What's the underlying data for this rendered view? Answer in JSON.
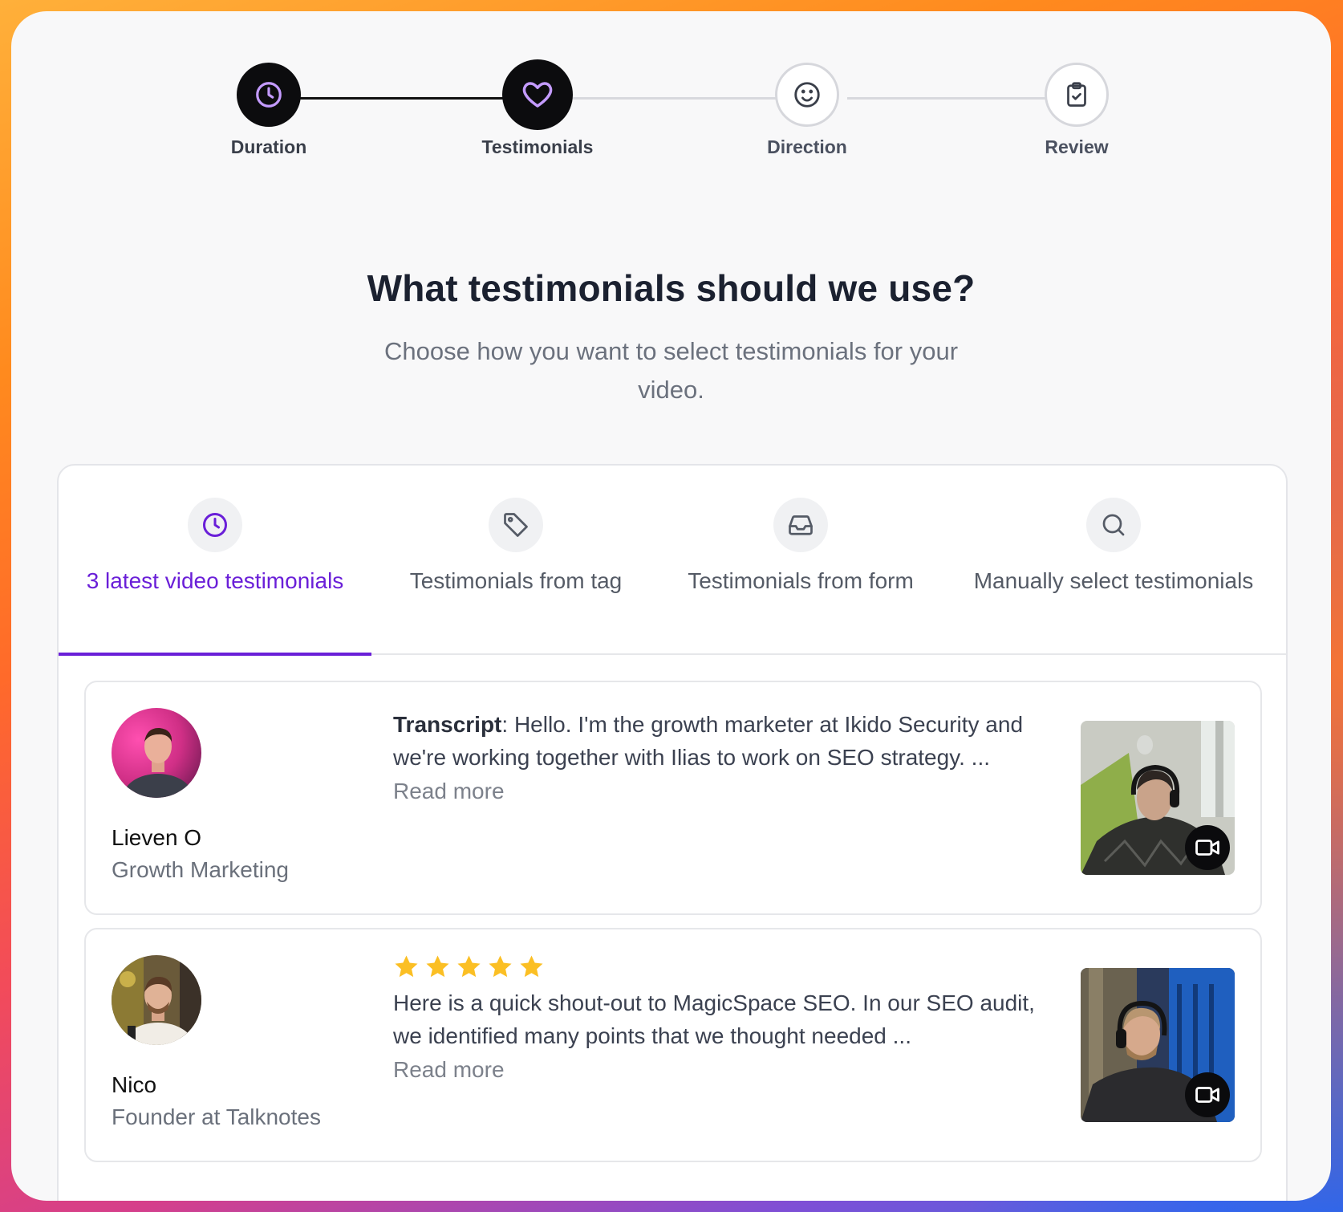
{
  "stepper": {
    "steps": [
      {
        "label": "Duration",
        "icon": "clock-icon",
        "state": "completed"
      },
      {
        "label": "Testimonials",
        "icon": "heart-icon",
        "state": "current"
      },
      {
        "label": "Direction",
        "icon": "smile-icon",
        "state": "upcoming"
      },
      {
        "label": "Review",
        "icon": "clipboard-check-icon",
        "state": "upcoming"
      }
    ]
  },
  "main": {
    "title": "What testimonials should we use?",
    "subtitle": "Choose how you want to select testimonials for your video."
  },
  "tabs": [
    {
      "label": "3 latest video testimonials",
      "icon": "clock-icon",
      "active": true
    },
    {
      "label": "Testimonials from tag",
      "icon": "tag-icon",
      "active": false
    },
    {
      "label": "Testimonials from form",
      "icon": "inbox-icon",
      "active": false
    },
    {
      "label": "Manually select testimonials",
      "icon": "search-icon",
      "active": false
    }
  ],
  "testimonials": [
    {
      "name": "Lieven O",
      "role": "Growth Marketing",
      "transcript_label": "Transcript",
      "text": ": Hello. I'm the growth marketer at Ikido Security and we're working together with Ilias to work on SEO strategy. ...",
      "read_more": "Read more",
      "rating": null
    },
    {
      "name": "Nico",
      "role": "Founder at Talknotes",
      "text": "Here is a quick shout-out to MagicSpace SEO. In our SEO audit, we identified many points that we thought needed ...",
      "read_more": "Read more",
      "rating": 5
    }
  ],
  "colors": {
    "accent": "#6a1fd8",
    "star": "#fbbf24",
    "active_step": "#0c0c0e"
  }
}
